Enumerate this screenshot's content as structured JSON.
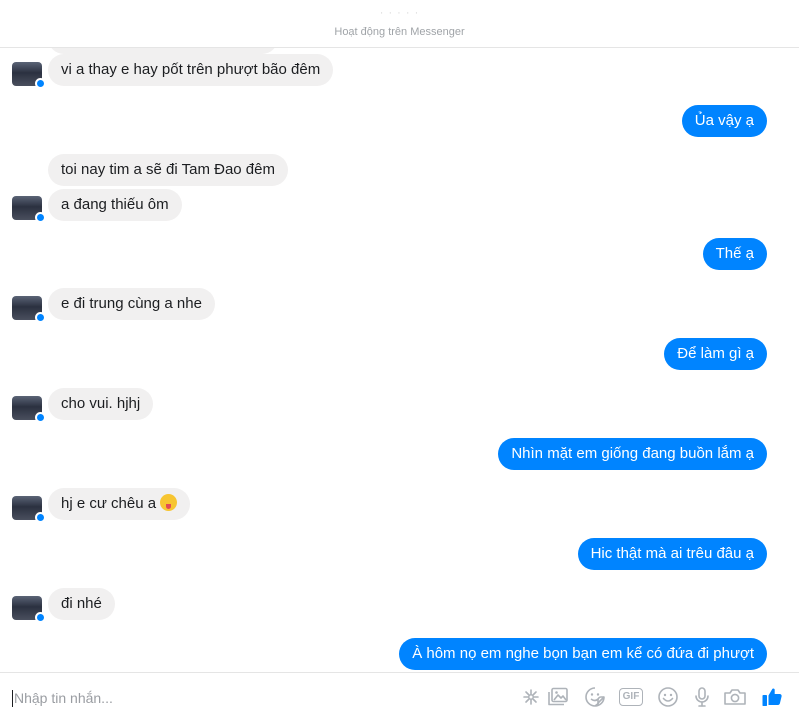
{
  "header": {
    "contact_name": "· · · · ·",
    "status": "Hoạt động trên Messenger"
  },
  "messages": [
    {
      "side": "in",
      "text": "vi a thay e hay pốt trên phượt bão đêm"
    },
    {
      "side": "out",
      "text": "Ủa vậy ạ"
    },
    {
      "side": "in",
      "text": "toi nay tim a sẽ đi Tam Đao đêm"
    },
    {
      "side": "in",
      "text": "a đang thiếu ôm"
    },
    {
      "side": "out",
      "text": "Thế ạ"
    },
    {
      "side": "in",
      "text": "e đi trung cùng a nhe"
    },
    {
      "side": "out",
      "text": "Để làm gì ạ"
    },
    {
      "side": "in",
      "text": "cho vui. hjhj"
    },
    {
      "side": "out",
      "text": "Nhìn mặt em giống đang buồn lắm ạ"
    },
    {
      "side": "in",
      "text": "hj e cư chêu a",
      "emoji": "tongue-out"
    },
    {
      "side": "out",
      "text": "Hic thật mà ai trêu đâu ạ"
    },
    {
      "side": "in",
      "text": "đi nhé"
    },
    {
      "side": "out",
      "text": "À hôm nọ em nghe bọn bạn em kể có đứa đi phượt"
    }
  ],
  "composer": {
    "placeholder": "Nhập tin nhắn...",
    "tools": [
      "sparkle-icon",
      "image-icon",
      "sticker-icon",
      "gif-icon",
      "emoji-icon",
      "microphone-icon",
      "camera-icon",
      "like-icon"
    ],
    "gif_label": "GIF"
  },
  "colors": {
    "outgoing_bubble": "#0084ff",
    "incoming_bubble": "#f1f0f0",
    "like": "#0084ff",
    "tool_gray": "#aeb3b9"
  }
}
